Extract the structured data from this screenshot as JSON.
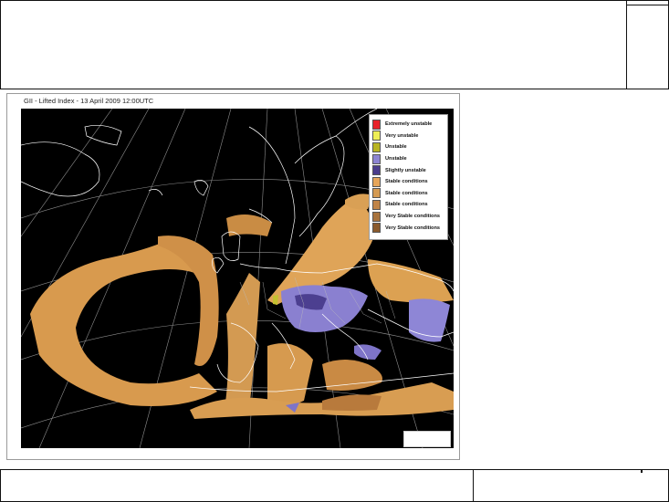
{
  "figure": {
    "title": "GII - Lifted Index - 13 April 2009 12:00UTC"
  },
  "legend": {
    "items": [
      {
        "label": "Extremely unstable",
        "color": "#e8222a"
      },
      {
        "label": "Very unstable",
        "color": "#eeee55"
      },
      {
        "label": "Unstable",
        "color": "#b8b422"
      },
      {
        "label": "Unstable",
        "color": "#8c84d2"
      },
      {
        "label": "Slightly unstable",
        "color": "#4a3d8c"
      },
      {
        "label": "Stable conditions",
        "color": "#e6a55a"
      },
      {
        "label": "Stable conditions",
        "color": "#d49a52"
      },
      {
        "label": "Stable conditions",
        "color": "#c08448"
      },
      {
        "label": "Very Stable conditions",
        "color": "#a8733d"
      },
      {
        "label": "Very Stable conditions",
        "color": "#8a5a2c"
      }
    ]
  },
  "map": {
    "background_color": "#000000",
    "coastline_color": "#ffffff",
    "graticule_color": "#9a9a9a"
  }
}
